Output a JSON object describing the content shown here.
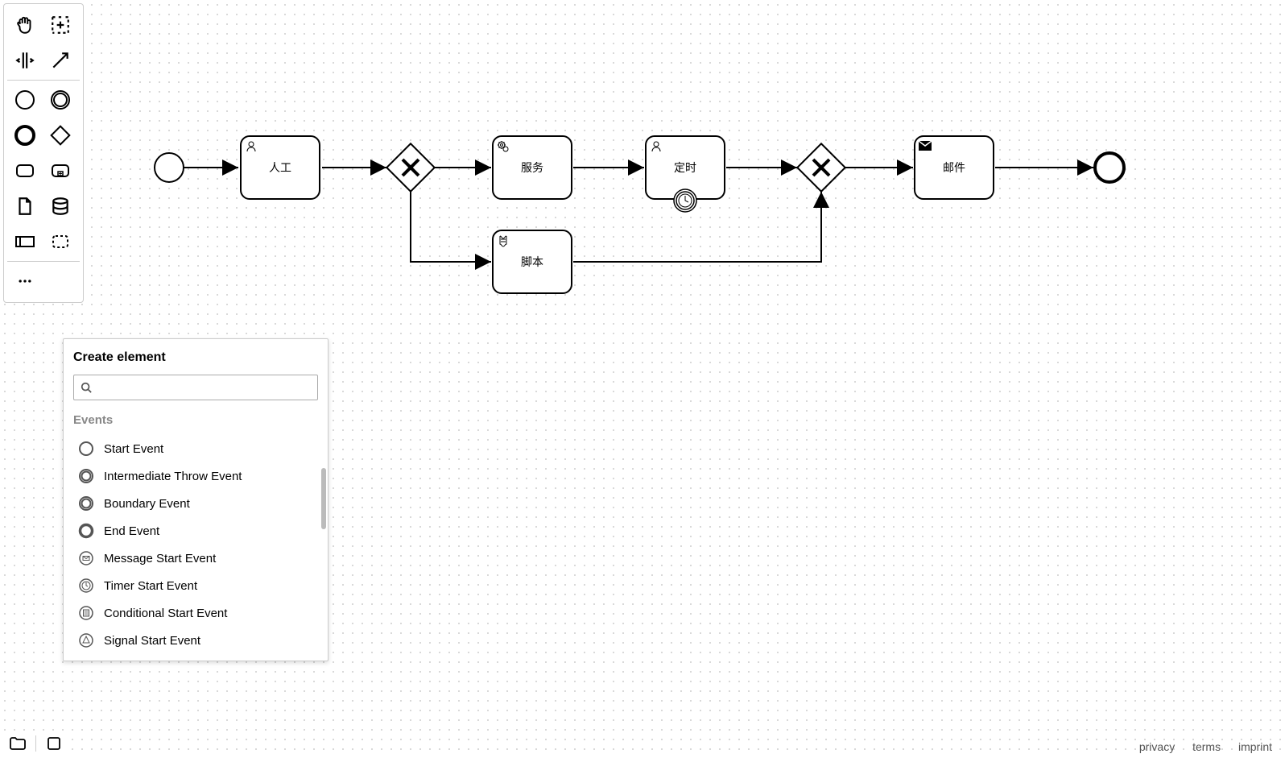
{
  "diagram": {
    "nodes": {
      "start": {
        "type": "startEvent"
      },
      "task_manual": {
        "label": "人工",
        "type": "userTask"
      },
      "gateway1": {
        "type": "exclusiveGateway"
      },
      "task_service": {
        "label": "服务",
        "type": "serviceTask"
      },
      "task_script": {
        "label": "脚本",
        "type": "scriptTask"
      },
      "task_timer": {
        "label": "定时",
        "type": "userTask",
        "boundary": "timer"
      },
      "gateway2": {
        "type": "exclusiveGateway"
      },
      "task_mail": {
        "label": "邮件",
        "type": "sendTask"
      },
      "end": {
        "type": "endEvent"
      }
    },
    "flows": [
      [
        "start",
        "task_manual"
      ],
      [
        "task_manual",
        "gateway1"
      ],
      [
        "gateway1",
        "task_service"
      ],
      [
        "gateway1",
        "task_script"
      ],
      [
        "task_service",
        "task_timer"
      ],
      [
        "task_timer",
        "gateway2"
      ],
      [
        "task_script",
        "gateway2"
      ],
      [
        "gateway2",
        "task_mail"
      ],
      [
        "task_mail",
        "end"
      ]
    ]
  },
  "popup": {
    "title": "Create element",
    "search_placeholder": "",
    "group": "Events",
    "items": [
      {
        "label": "Start Event",
        "icon": "start"
      },
      {
        "label": "Intermediate Throw Event",
        "icon": "intermediate"
      },
      {
        "label": "Boundary Event",
        "icon": "intermediate"
      },
      {
        "label": "End Event",
        "icon": "end"
      },
      {
        "label": "Message Start Event",
        "icon": "message"
      },
      {
        "label": "Timer Start Event",
        "icon": "timer"
      },
      {
        "label": "Conditional Start Event",
        "icon": "conditional"
      },
      {
        "label": "Signal Start Event",
        "icon": "signal"
      }
    ]
  },
  "footer": {
    "privacy": "privacy",
    "terms": "terms",
    "imprint": "imprint"
  }
}
